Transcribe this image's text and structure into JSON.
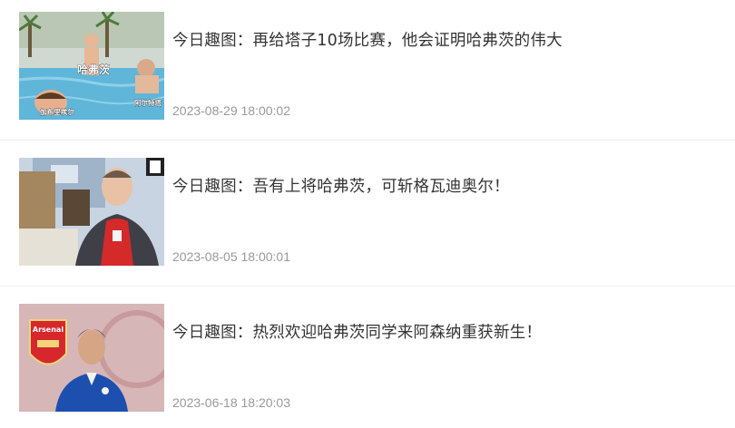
{
  "articles": [
    {
      "title": "今日趣图：再给塔子10场比赛，他会证明哈弗茨的伟大",
      "time": "2023-08-29 18:00:02",
      "image_captions": {
        "center": "哈弗茨",
        "right": "阿尔特塔",
        "bottom_left": "加布里埃尔"
      }
    },
    {
      "title": "今日趣图：吾有上将哈弗茨，可斩格瓦迪奥尔！",
      "time": "2023-08-05 18:00:01"
    },
    {
      "title": "今日趣图：热烈欢迎哈弗茨同学来阿森纳重获新生！",
      "time": "2023-06-18 18:20:03",
      "image_captions": {
        "crest": "Arsenal"
      }
    }
  ]
}
